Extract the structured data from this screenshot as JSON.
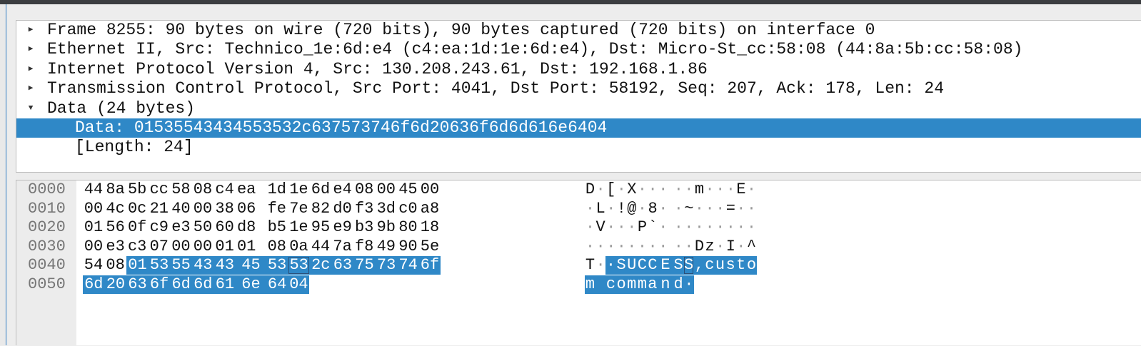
{
  "tree": {
    "rows": [
      {
        "text": "Frame 8255: 90 bytes on wire (720 bits), 90 bytes captured (720 bits) on interface 0",
        "expanded": false,
        "indent": 0
      },
      {
        "text": "Ethernet II, Src: Technico_1e:6d:e4 (c4:ea:1d:1e:6d:e4), Dst: Micro-St_cc:58:08 (44:8a:5b:cc:58:08)",
        "expanded": false,
        "indent": 0
      },
      {
        "text": "Internet Protocol Version 4, Src: 130.208.243.61, Dst: 192.168.1.86",
        "expanded": false,
        "indent": 0
      },
      {
        "text": "Transmission Control Protocol, Src Port: 4041, Dst Port: 58192, Seq: 207, Ack: 178, Len: 24",
        "expanded": false,
        "indent": 0
      },
      {
        "text": "Data (24 bytes)",
        "expanded": true,
        "indent": 0
      },
      {
        "text": "Data: 01535543434553532c637573746f6d20636f6d6d616e6404",
        "indent": 1,
        "selected": true
      },
      {
        "text": "[Length: 24]",
        "indent": 1
      }
    ]
  },
  "bytes": {
    "lines": [
      {
        "offset": "0000",
        "hex": [
          "44",
          "8a",
          "5b",
          "cc",
          "58",
          "08",
          "c4",
          "ea",
          "1d",
          "1e",
          "6d",
          "e4",
          "08",
          "00",
          "45",
          "00"
        ],
        "ascii": [
          "D",
          "·",
          "[",
          "·",
          "X",
          "·",
          "·",
          "·",
          "·",
          "·",
          "m",
          "·",
          "·",
          "·",
          "E",
          "·"
        ]
      },
      {
        "offset": "0010",
        "hex": [
          "00",
          "4c",
          "0c",
          "21",
          "40",
          "00",
          "38",
          "06",
          "fe",
          "7e",
          "82",
          "d0",
          "f3",
          "3d",
          "c0",
          "a8"
        ],
        "ascii": [
          "·",
          "L",
          "·",
          "!",
          "@",
          "·",
          "8",
          "·",
          "·",
          "~",
          "·",
          "·",
          "·",
          "=",
          "·",
          "·"
        ]
      },
      {
        "offset": "0020",
        "hex": [
          "01",
          "56",
          "0f",
          "c9",
          "e3",
          "50",
          "60",
          "d8",
          "b5",
          "1e",
          "95",
          "e9",
          "b3",
          "9b",
          "80",
          "18"
        ],
        "ascii": [
          "·",
          "V",
          "·",
          "·",
          "·",
          "P",
          "`",
          "·",
          "·",
          "·",
          "·",
          "·",
          "·",
          "·",
          "·",
          "·"
        ]
      },
      {
        "offset": "0030",
        "hex": [
          "00",
          "e3",
          "c3",
          "07",
          "00",
          "00",
          "01",
          "01",
          "08",
          "0a",
          "44",
          "7a",
          "f8",
          "49",
          "90",
          "5e"
        ],
        "ascii": [
          "·",
          "·",
          "·",
          "·",
          "·",
          "·",
          "·",
          "·",
          "·",
          "·",
          "D",
          "z",
          "·",
          "I",
          "·",
          "^"
        ]
      },
      {
        "offset": "0040",
        "hex": [
          "54",
          "08",
          "01",
          "53",
          "55",
          "43",
          "43",
          "45",
          "53",
          "53",
          "2c",
          "63",
          "75",
          "73",
          "74",
          "6f"
        ],
        "ascii": [
          "T",
          "·",
          "·",
          "S",
          "U",
          "C",
          "C",
          "E",
          "S",
          "S",
          ",",
          "c",
          "u",
          "s",
          "t",
          "o"
        ]
      },
      {
        "offset": "0050",
        "hex": [
          "6d",
          "20",
          "63",
          "6f",
          "6d",
          "6d",
          "61",
          "6e",
          "64",
          "04"
        ],
        "ascii": [
          "m",
          " ",
          "c",
          "o",
          "m",
          "m",
          "a",
          "n",
          "d",
          "·"
        ]
      }
    ],
    "selection": {
      "start": 66,
      "end": 89
    },
    "cursor": 73
  }
}
